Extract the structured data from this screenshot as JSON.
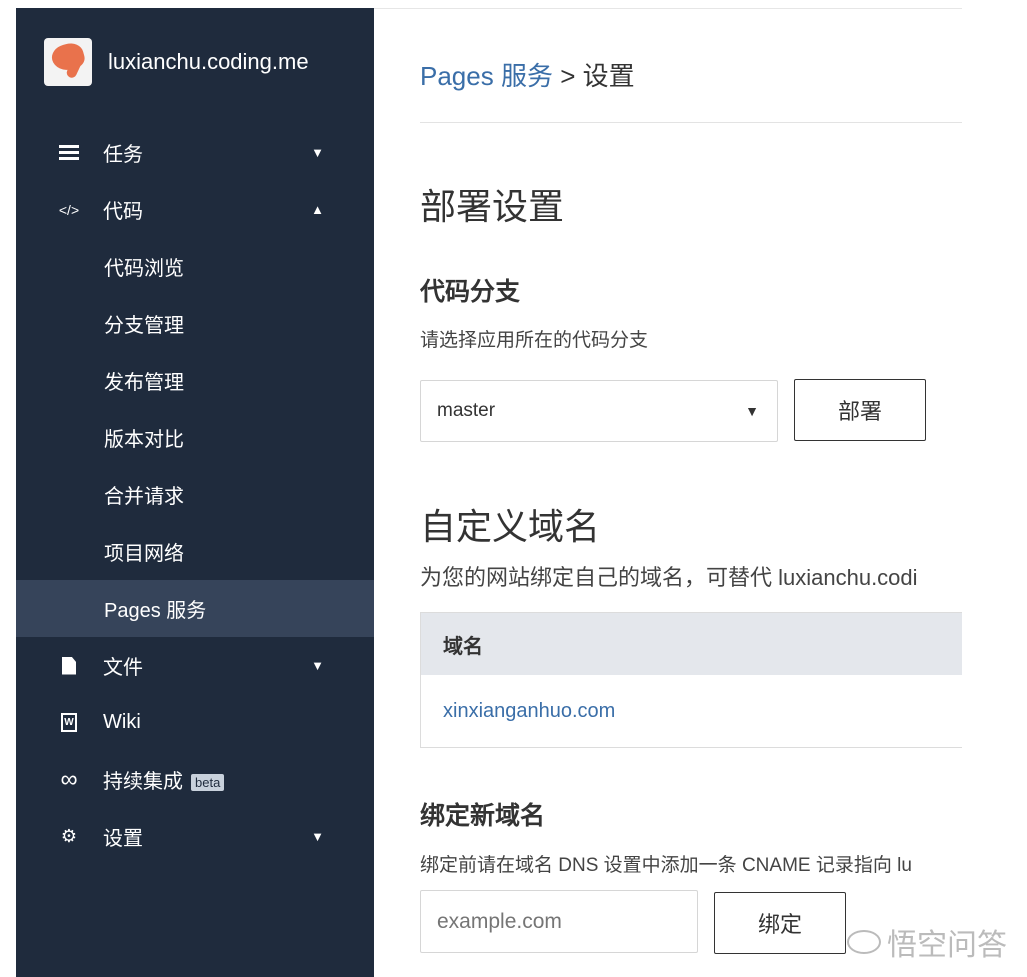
{
  "brand": {
    "name": "luxianchu.coding.me"
  },
  "sidebar": {
    "items": [
      {
        "label": "任务",
        "icon": "list-icon",
        "caret": "▼"
      },
      {
        "label": "代码",
        "icon": "code-icon",
        "caret": "▲"
      },
      {
        "label": "代码浏览"
      },
      {
        "label": "分支管理"
      },
      {
        "label": "发布管理"
      },
      {
        "label": "版本对比"
      },
      {
        "label": "合并请求"
      },
      {
        "label": "项目网络"
      },
      {
        "label": "Pages 服务"
      },
      {
        "label": "文件",
        "icon": "file-icon",
        "caret": "▼"
      },
      {
        "label": "Wiki",
        "icon": "wiki-icon"
      },
      {
        "label": "持续集成",
        "icon": "infinity-icon",
        "badge": "beta"
      },
      {
        "label": "设置",
        "icon": "gears-icon",
        "caret": "▼"
      }
    ]
  },
  "breadcrumb": {
    "link": "Pages 服务",
    "sep": ">",
    "current": "设置"
  },
  "deploy": {
    "title": "部署设置",
    "branch_title": "代码分支",
    "branch_hint": "请选择应用所在的代码分支",
    "branch_value": "master",
    "deploy_button": "部署"
  },
  "domain": {
    "title": "自定义域名",
    "desc": "为您的网站绑定自己的域名，可替代 luxianchu.codi",
    "table_header": "域名",
    "rows": [
      "xinxianganhuo.com"
    ]
  },
  "bind": {
    "title": "绑定新域名",
    "hint": "绑定前请在域名 DNS 设置中添加一条 CNAME 记录指向 lu",
    "placeholder": "example.com",
    "button": "绑定"
  },
  "watermark": {
    "text": "悟空问答"
  }
}
